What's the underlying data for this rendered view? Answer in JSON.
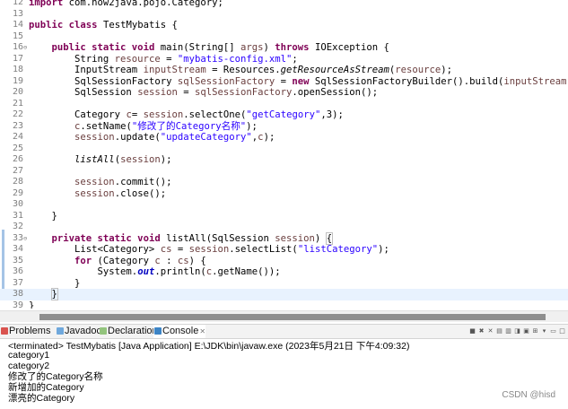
{
  "editor": {
    "lines": [
      {
        "num": "12",
        "code": "import com.how2java.pojo.Category;"
      },
      {
        "num": "13",
        "code": ""
      },
      {
        "num": "14",
        "code": "public class TestMybatis {"
      },
      {
        "num": "15",
        "code": ""
      },
      {
        "num": "16",
        "code": "    public static void main(String[] args) throws IOException {"
      },
      {
        "num": "17",
        "code": "        String resource = \"mybatis-config.xml\";"
      },
      {
        "num": "18",
        "code": "        InputStream inputStream = Resources.getResourceAsStream(resource);"
      },
      {
        "num": "19",
        "code": "        SqlSessionFactory sqlSessionFactory = new SqlSessionFactoryBuilder().build(inputStream"
      },
      {
        "num": "20",
        "code": "        SqlSession session = sqlSessionFactory.openSession();"
      },
      {
        "num": "21",
        "code": ""
      },
      {
        "num": "22",
        "code": "        Category c= session.selectOne(\"getCategory\",3);"
      },
      {
        "num": "23",
        "code": "        c.setName(\"修改了的Category名称\");"
      },
      {
        "num": "24",
        "code": "        session.update(\"updateCategory\",c);"
      },
      {
        "num": "25",
        "code": ""
      },
      {
        "num": "26",
        "code": "        listAll(session);"
      },
      {
        "num": "27",
        "code": ""
      },
      {
        "num": "28",
        "code": "        session.commit();"
      },
      {
        "num": "29",
        "code": "        session.close();"
      },
      {
        "num": "30",
        "code": ""
      },
      {
        "num": "31",
        "code": "    }"
      },
      {
        "num": "32",
        "code": ""
      },
      {
        "num": "33",
        "code": "    private static void listAll(SqlSession session) {"
      },
      {
        "num": "34",
        "code": "        List<Category> cs = session.selectList(\"listCategory\");"
      },
      {
        "num": "35",
        "code": "        for (Category c : cs) {"
      },
      {
        "num": "36",
        "code": "            System.out.println(c.getName());"
      },
      {
        "num": "37",
        "code": "        }"
      },
      {
        "num": "38",
        "code": "    }"
      },
      {
        "num": "39",
        "code": "}"
      }
    ]
  },
  "panel": {
    "tabs": [
      {
        "label": "Problems",
        "color": "#d9534f"
      },
      {
        "label": "Javadoc",
        "color": "#6fa8dc"
      },
      {
        "label": "Declaration",
        "color": "#93c47d"
      },
      {
        "label": "Console",
        "color": "#3d85c6"
      }
    ],
    "active_tab": "Console",
    "toolbar_icons": [
      "terminate-icon",
      "remove-launch-icon",
      "remove-all-icon",
      "scroll-lock-icon",
      "word-wrap-icon",
      "pin-console-icon",
      "display-selected-icon",
      "open-console-icon",
      "view-menu-icon",
      "minimize-icon",
      "maximize-icon"
    ],
    "console_header": "<terminated> TestMybatis [Java Application] E:\\JDK\\bin\\javaw.exe (2023年5月21日 下午4:09:32)",
    "console_output": [
      "category1",
      "category2",
      "修改了的Category名称",
      "新增加的Category",
      "漂亮的Category"
    ]
  },
  "watermark": "CSDN @hisd"
}
